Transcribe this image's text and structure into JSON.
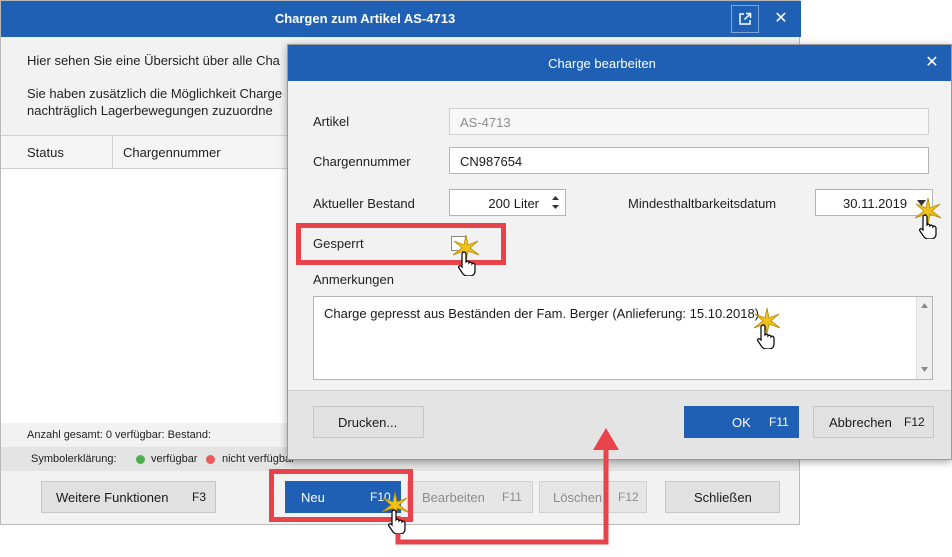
{
  "bg_window": {
    "title": "Chargen zum Artikel AS-4713",
    "popout_icon": "popout-icon",
    "close_glyph": "✕",
    "intro_line1": "Hier sehen Sie eine Übersicht über alle Cha",
    "intro_line2": "Sie haben zusätzlich die Möglichkeit Charge",
    "intro_line3": "nachträglich Lagerbewegungen zuzuordne",
    "columns": [
      "Status",
      "Chargennummer"
    ],
    "status_line": "Anzahl gesamt: 0   verfügbar:      Bestand:",
    "legend": {
      "label": "Symbolerklärung:",
      "available": "verfügbar",
      "unavailable": "nicht verfügbar",
      "available_color": "#4caf50",
      "unavailable_color": "#e85c5c"
    },
    "buttons": {
      "more_functions": "Weitere Funktionen",
      "more_functions_key": "F3",
      "new": "Neu",
      "new_key": "F10",
      "edit": "Bearbeiten",
      "edit_key": "F11",
      "delete": "Löschen",
      "delete_key": "F12",
      "close": "Schließen"
    }
  },
  "dialog": {
    "title": "Charge bearbeiten",
    "close_glyph": "✕",
    "article_label": "Artikel",
    "article_value": "AS-4713",
    "batch_label": "Chargennummer",
    "batch_value": "CN987654",
    "stock_label": "Aktueller Bestand",
    "stock_value": "200 Liter",
    "bbd_label": "Mindesthaltbarkeitsdatum",
    "bbd_value": "30.11.2019",
    "locked_label": "Gesperrt",
    "locked_checked": false,
    "notes_label": "Anmerkungen",
    "notes_value": "Charge gepresst aus Beständen der Fam. Berger (Anlieferung: 15.10.2018)",
    "buttons": {
      "print": "Drucken...",
      "ok": "OK",
      "ok_key": "F11",
      "cancel": "Abbrechen",
      "cancel_key": "F12"
    }
  },
  "colors": {
    "accent": "#1f5fb4",
    "highlight": "#e8434a"
  }
}
